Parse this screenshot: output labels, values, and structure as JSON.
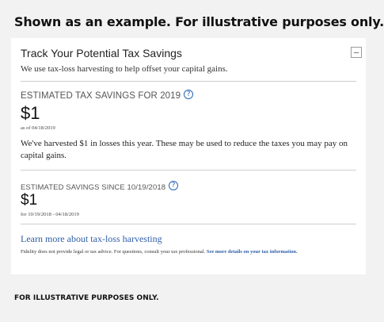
{
  "top_caption": "Shown as an example. For illustrative purposes only.",
  "card": {
    "title": "Track Your Potential Tax Savings",
    "subtitle": "We use tax-loss harvesting to help offset your capital gains.",
    "collapse_icon": "minus-box-icon",
    "estimated": {
      "label": "ESTIMATED TAX SAVINGS FOR 2019",
      "info_icon": "?",
      "amount": "$1",
      "as_of": "as of 04/18/2019",
      "description": "We've harvested $1 in losses this year. These may be used to reduce the taxes you may pay on capital gains."
    },
    "since": {
      "label": "ESTIMATED SAVINGS SINCE 10/19/2018",
      "info_icon": "?",
      "amount": "$1",
      "period": "for 10/19/2018 - 04/18/2019"
    },
    "learn_more": "Learn more about tax-loss harvesting",
    "disclaimer_text": "Fidelity does not provide legal or tax advice. For questions, consult your tax professional.",
    "disclaimer_link": "See more details on your tax information."
  },
  "bottom_caption": "FOR ILLUSTRATIVE PURPOSES ONLY.",
  "colors": {
    "link": "#2f5ea8",
    "background": "#f2f2f2",
    "card": "#ffffff"
  }
}
